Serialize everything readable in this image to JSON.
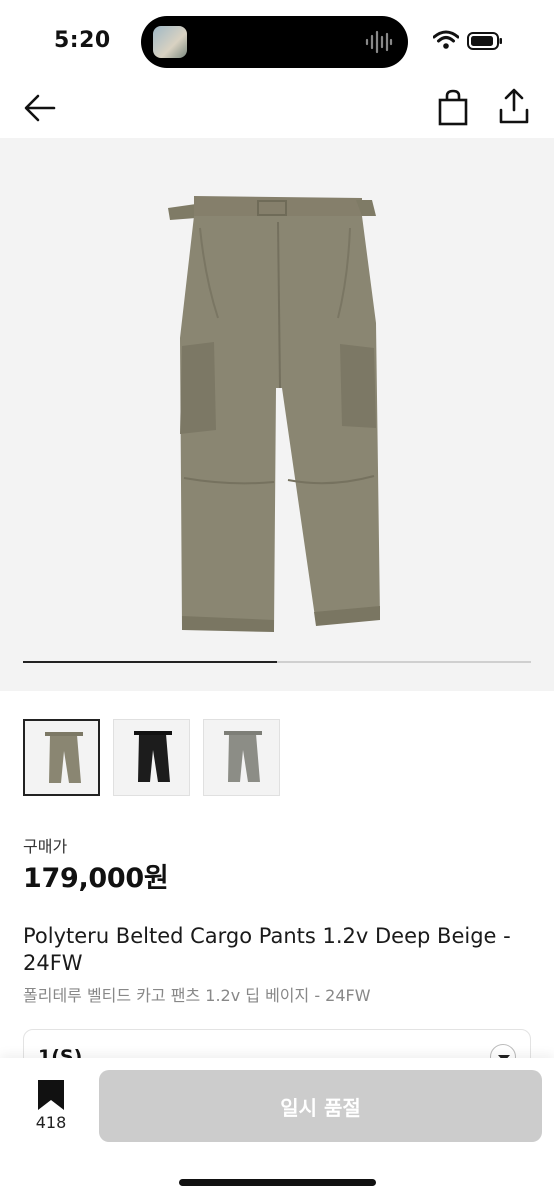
{
  "status_bar": {
    "time": "5:20"
  },
  "nav": {
    "back": "back-arrow-icon",
    "bag": "shopping-bag-icon",
    "share": "share-icon"
  },
  "gallery": {
    "progress": 0.5,
    "thumbnails": [
      {
        "color": "olive",
        "selected": true
      },
      {
        "color": "black",
        "selected": false
      },
      {
        "color": "gray",
        "selected": false
      }
    ]
  },
  "product": {
    "price_label": "구매가",
    "price": "179,000원",
    "title": "Polyteru Belted Cargo Pants 1.2v Deep Beige - 24FW",
    "subtitle": "폴리테루 벨티드 카고 팬츠 1.2v 딥 베이지 - 24FW"
  },
  "option": {
    "selected": "1(S)"
  },
  "bottom": {
    "bookmark_count": "418",
    "button_label": "일시 품절"
  },
  "colors": {
    "olive": "#8a8672",
    "black": "#1c1c1c",
    "gray": "#8c8d86",
    "button_disabled": "#cccccc"
  }
}
